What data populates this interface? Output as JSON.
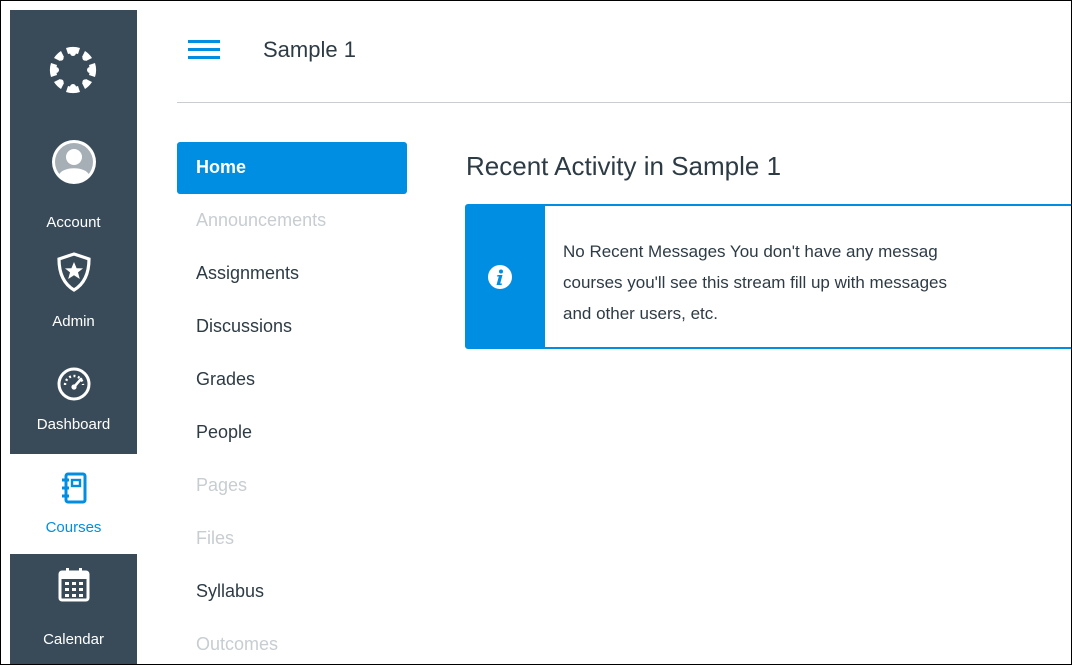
{
  "global_nav": {
    "items": [
      {
        "label": "Account",
        "icon": "avatar-icon"
      },
      {
        "label": "Admin",
        "icon": "shield-star-icon"
      },
      {
        "label": "Dashboard",
        "icon": "speedometer-icon"
      },
      {
        "label": "Courses",
        "icon": "notebook-icon",
        "active": true
      },
      {
        "label": "Calendar",
        "icon": "calendar-icon"
      }
    ]
  },
  "header": {
    "breadcrumb": "Sample 1"
  },
  "course_nav": {
    "items": [
      {
        "label": "Home",
        "state": "active"
      },
      {
        "label": "Announcements",
        "state": "disabled"
      },
      {
        "label": "Assignments",
        "state": "enabled"
      },
      {
        "label": "Discussions",
        "state": "enabled"
      },
      {
        "label": "Grades",
        "state": "enabled"
      },
      {
        "label": "People",
        "state": "enabled"
      },
      {
        "label": "Pages",
        "state": "disabled"
      },
      {
        "label": "Files",
        "state": "disabled"
      },
      {
        "label": "Syllabus",
        "state": "enabled"
      },
      {
        "label": "Outcomes",
        "state": "disabled"
      }
    ]
  },
  "main": {
    "title": "Recent Activity in Sample 1",
    "alert": {
      "lines": [
        "No Recent Messages  You don't have any messag",
        "courses you'll see this stream fill up with messages",
        "and other users, etc."
      ]
    }
  },
  "colors": {
    "nav_bg": "#394b58",
    "accent": "#008ee2",
    "text": "#2d3b45",
    "disabled": "#c7cdd1"
  }
}
